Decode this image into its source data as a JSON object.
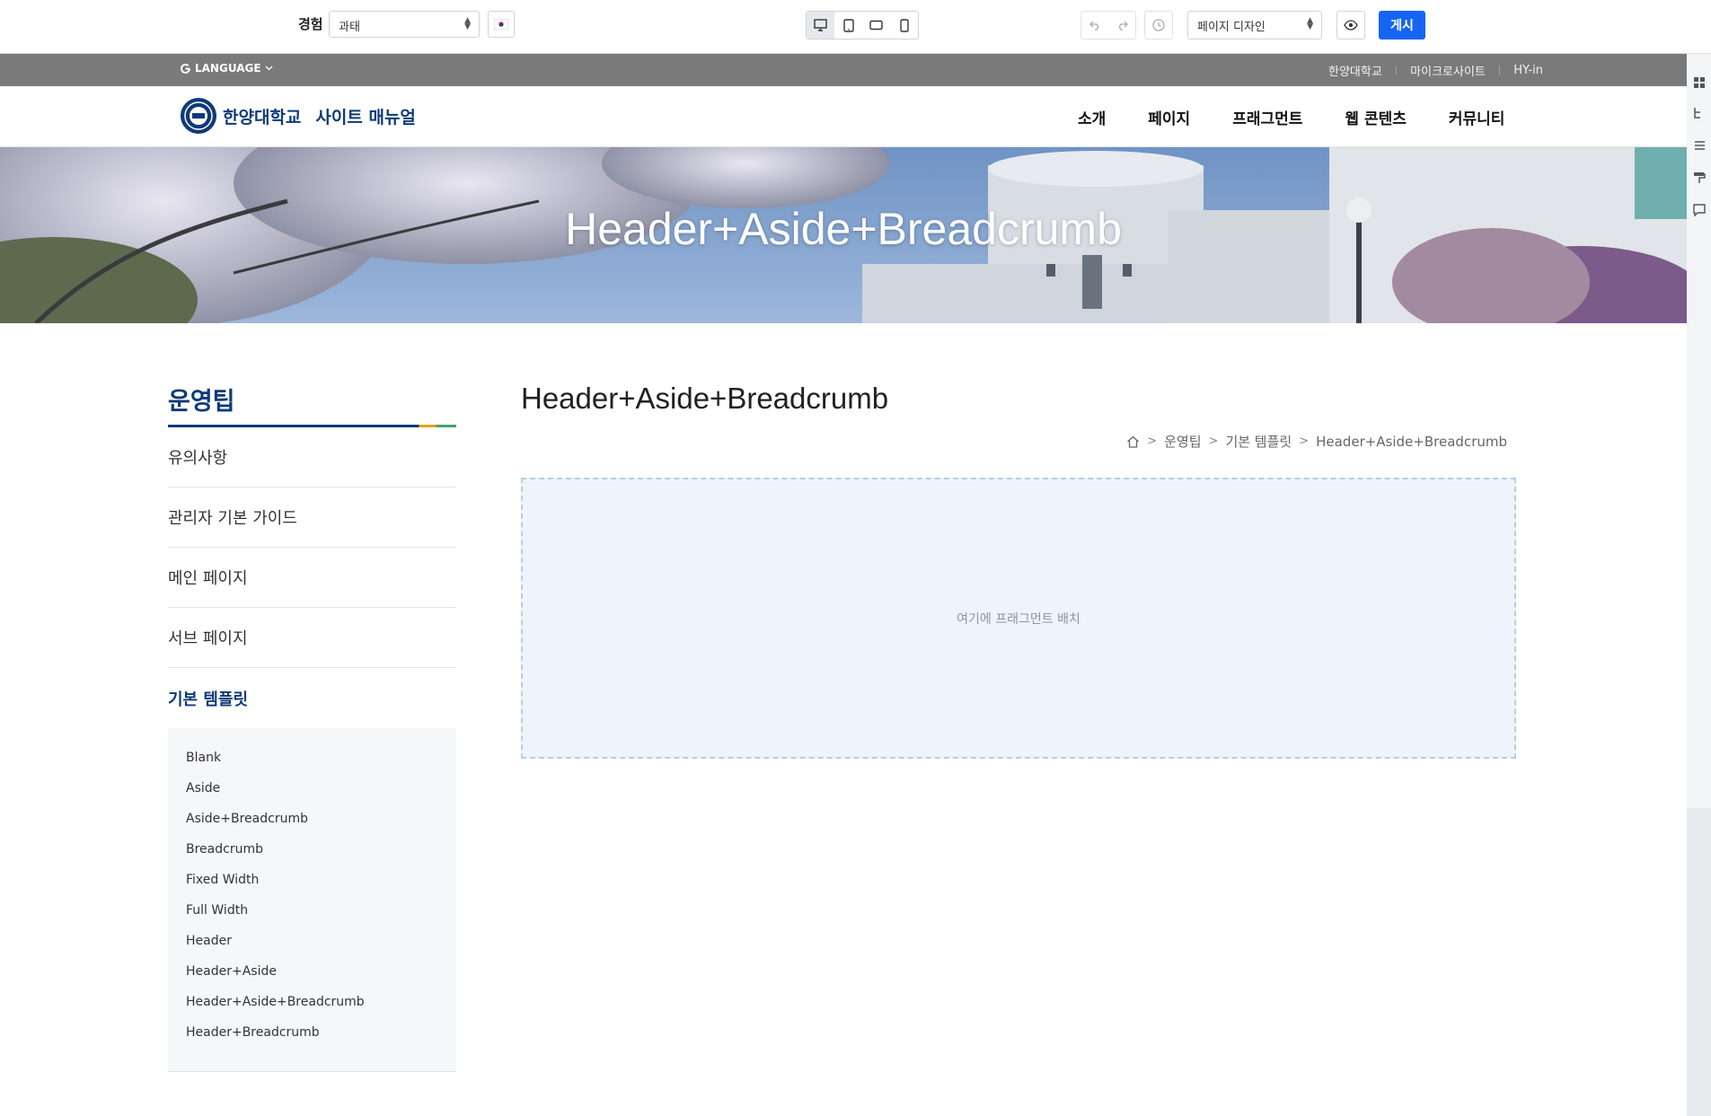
{
  "editor": {
    "experience_label": "경험",
    "experience_value": "과태",
    "mode_value": "페이지 디자인",
    "publish_label": "게시",
    "devices": [
      "desktop-icon",
      "tablet-icon",
      "tablet-landscape-icon",
      "mobile-icon"
    ]
  },
  "topbar": {
    "language": "LANGUAGE",
    "links": [
      "한양대학교",
      "마이크로사이트",
      "HY-in"
    ]
  },
  "header": {
    "logo_text": "한양대학교",
    "site_name": "사이트 매뉴얼",
    "nav": [
      "소개",
      "페이지",
      "프래그먼트",
      "웹 콘텐츠",
      "커뮤니티"
    ]
  },
  "hero": {
    "title": "Header+Aside+Breadcrumb"
  },
  "aside": {
    "title": "운영팁",
    "items": [
      "유의사항",
      "관리자 기본 가이드",
      "메인 페이지",
      "서브 페이지",
      "기본 템플릿"
    ],
    "subitems": [
      "Blank",
      "Aside",
      "Aside+Breadcrumb",
      "Breadcrumb",
      "Fixed Width",
      "Full Width",
      "Header",
      "Header+Aside",
      "Header+Aside+Breadcrumb",
      "Header+Breadcrumb"
    ]
  },
  "content": {
    "title": "Header+Aside+Breadcrumb",
    "breadcrumb": [
      "운영팁",
      "기본 템플릿",
      "Header+Aside+Breadcrumb"
    ],
    "dropzone_text": "여기에 프래그먼트 배치"
  },
  "colors": {
    "accent": "#1565f5",
    "brand": "#0e3a78",
    "topstrip": "#7a7a7a"
  }
}
